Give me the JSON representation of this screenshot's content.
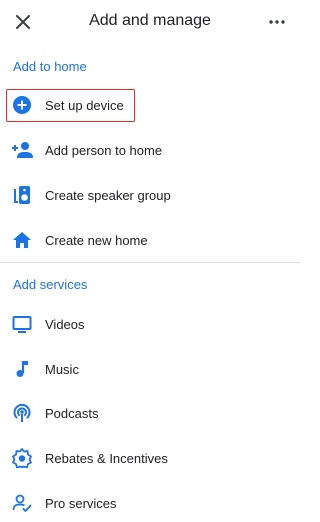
{
  "header": {
    "title": "Add and manage",
    "close_icon": "close-icon",
    "more_icon": "more-horizontal-icon"
  },
  "sections": {
    "home": {
      "title": "Add to home",
      "items": [
        {
          "label": "Set up device",
          "icon": "add-circle-icon"
        },
        {
          "label": "Add person to home",
          "icon": "add-person-icon"
        },
        {
          "label": "Create speaker group",
          "icon": "speaker-group-icon"
        },
        {
          "label": "Create new home",
          "icon": "home-icon"
        }
      ]
    },
    "services": {
      "title": "Add services",
      "items": [
        {
          "label": "Videos",
          "icon": "tv-icon"
        },
        {
          "label": "Music",
          "icon": "music-note-icon"
        },
        {
          "label": "Podcasts",
          "icon": "podcast-icon"
        },
        {
          "label": "Rebates & Incentives",
          "icon": "rebates-badge-icon"
        },
        {
          "label": "Pro services",
          "icon": "pro-services-icon"
        }
      ]
    }
  },
  "colors": {
    "accent": "#1a73e8",
    "highlight": "#d93025",
    "text": "#202124",
    "divider": "#e0e0e0"
  }
}
